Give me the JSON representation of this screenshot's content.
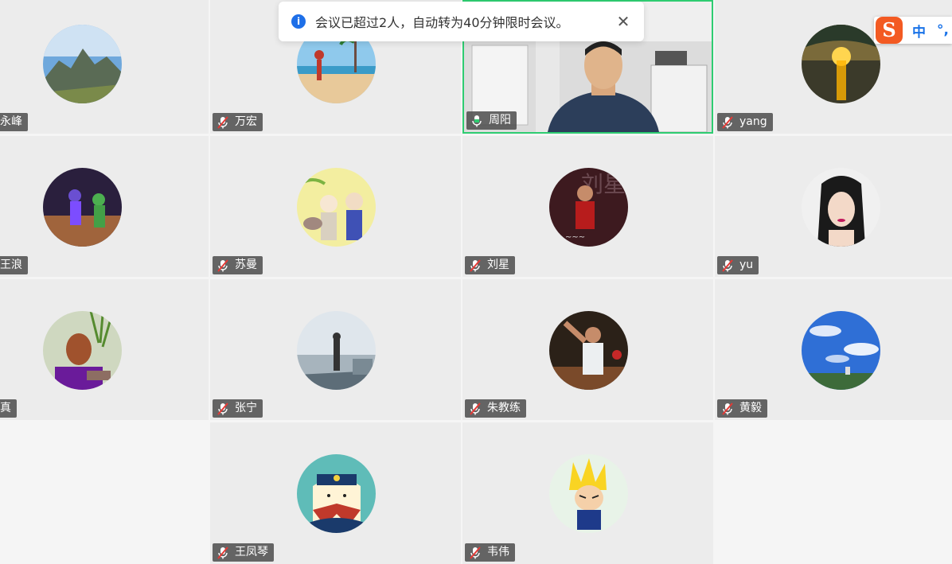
{
  "notice": {
    "message": "会议已超过2人，自动转为40分钟限时会议。",
    "info_glyph": "i",
    "close_glyph": "✕"
  },
  "ime": {
    "logo": "S",
    "mode": "中",
    "punct": "°,"
  },
  "participants": [
    {
      "name": "永峰",
      "avatar": "mountain-photo",
      "muted": true
    },
    {
      "name": "万宏",
      "avatar": "beach-yoga-photo",
      "muted": true
    },
    {
      "name": "周阳",
      "avatar": "live-video",
      "muted": false,
      "active_speaker": true
    },
    {
      "name": "yang",
      "avatar": "sunset-photo",
      "muted": true
    },
    {
      "name": "王浪",
      "avatar": "basketball-photo",
      "muted": true
    },
    {
      "name": "苏曼",
      "avatar": "illustration-couple",
      "muted": true
    },
    {
      "name": "刘星",
      "avatar": "basketball-player-photo",
      "muted": true
    },
    {
      "name": "yu",
      "avatar": "woman-portrait",
      "muted": true
    },
    {
      "name": "真",
      "avatar": "man-with-plant-photo",
      "muted": true
    },
    {
      "name": "张宁",
      "avatar": "lake-person-photo",
      "muted": true
    },
    {
      "name": "朱教练",
      "avatar": "basketball-dunk-photo",
      "muted": true
    },
    {
      "name": "黄毅",
      "avatar": "blue-sky-photo",
      "muted": true
    },
    {
      "name": "王凤琴",
      "avatar": "sailor-penguin-illustration",
      "muted": true
    },
    {
      "name": "韦伟",
      "avatar": "anime-character",
      "muted": true
    }
  ],
  "colors": {
    "active_border": "#2ecc71",
    "tile_bg": "#ececec",
    "info_blue": "#1e6fe8",
    "ime_orange": "#f35a22"
  }
}
